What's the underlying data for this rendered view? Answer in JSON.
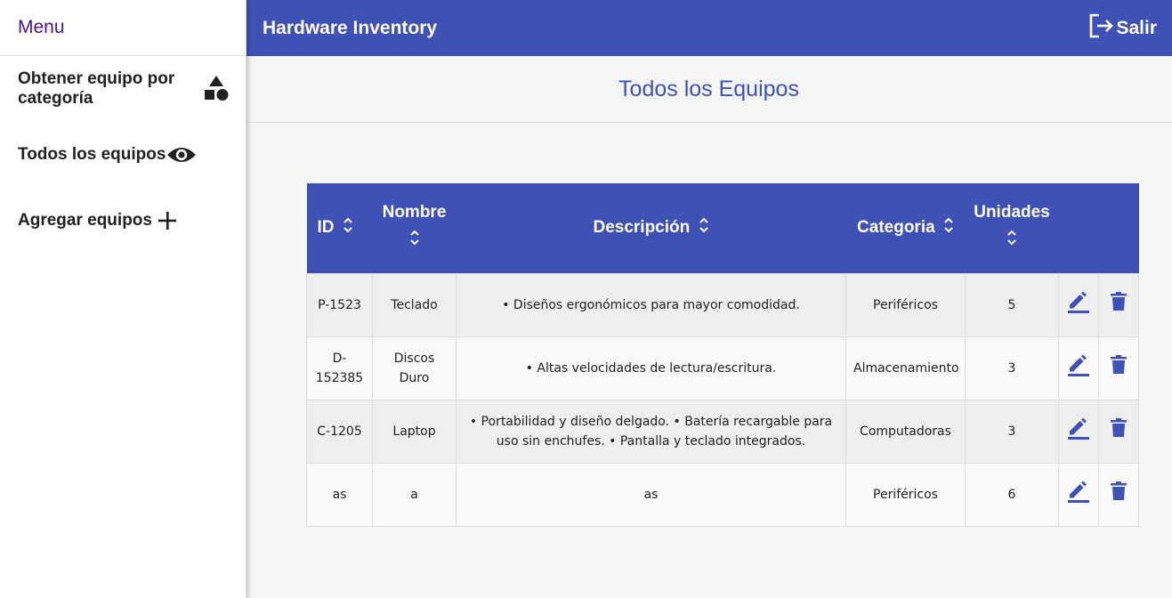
{
  "sidebar": {
    "title": "Menu",
    "items": [
      {
        "label": "Obtener equipo por categoría",
        "icon": "shapes-icon"
      },
      {
        "label": "Todos los equipos",
        "icon": "eye-icon"
      },
      {
        "label": "Agregar equipos",
        "icon": "plus-icon"
      }
    ]
  },
  "header": {
    "title": "Hardware Inventory",
    "logout_label": "Salir",
    "logout_icon": "logout-icon"
  },
  "main": {
    "title": "Todos los Equipos"
  },
  "table": {
    "columns": [
      "ID",
      "Nombre",
      "Descripción",
      "Categoria",
      "Unidades"
    ],
    "rows": [
      {
        "id": "P-1523",
        "nombre": "Teclado",
        "descripcion": "• Diseños ergonómicos para mayor comodidad.",
        "categoria": "Periféricos",
        "unidades": "5"
      },
      {
        "id": "D-152385",
        "nombre": "Discos Duro",
        "descripcion": "• Altas velocidades de lectura/escritura.",
        "categoria": "Almacenamiento",
        "unidades": "3"
      },
      {
        "id": "C-1205",
        "nombre": "Laptop",
        "descripcion": "• Portabilidad y diseño delgado. • Batería recargable para uso sin enchufes. • Pantalla y teclado integrados.",
        "categoria": "Computadoras",
        "unidades": "3"
      },
      {
        "id": "as",
        "nombre": "a",
        "descripcion": "as",
        "categoria": "Periféricos",
        "unidades": "6"
      }
    ]
  },
  "colors": {
    "primary": "#3f51b5",
    "menu_title": "#4a148c",
    "background": "#f5f5f5"
  }
}
